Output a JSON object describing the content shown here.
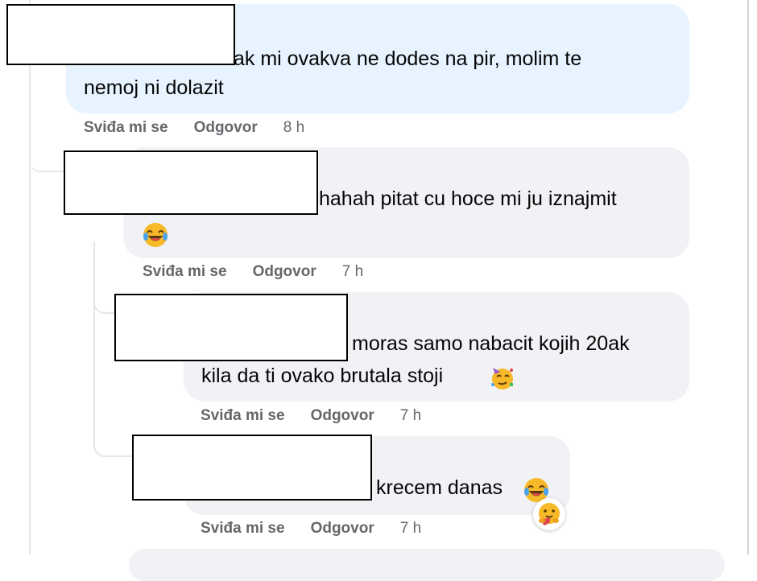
{
  "actions": {
    "like_label": "Sviđa mi se",
    "reply_label": "Odgovor"
  },
  "comments": [
    {
      "line1": "ak mi ovakva ne dodes na pir, molim te",
      "line2": "nemoj ni dolazit",
      "time": "8 h"
    },
    {
      "line1": "hahah pitat cu hoce mi ju iznajmit",
      "emoji": "laughing-emoji",
      "time": "7 h"
    },
    {
      "line1": "moras samo nabacit kojih 20ak",
      "line2": "kila da ti ovako brutala stoji",
      "emoji": "partying-face-emoji",
      "time": "7 h"
    },
    {
      "line1": "krecem danas",
      "emoji": "laughing-emoji",
      "reaction": "care-reaction-emoji",
      "time": "7 h"
    }
  ],
  "colors": {
    "blue_bubble": "#e7f3ff",
    "grey_bubble": "#f0f2f5",
    "meta_text": "#65676b"
  }
}
